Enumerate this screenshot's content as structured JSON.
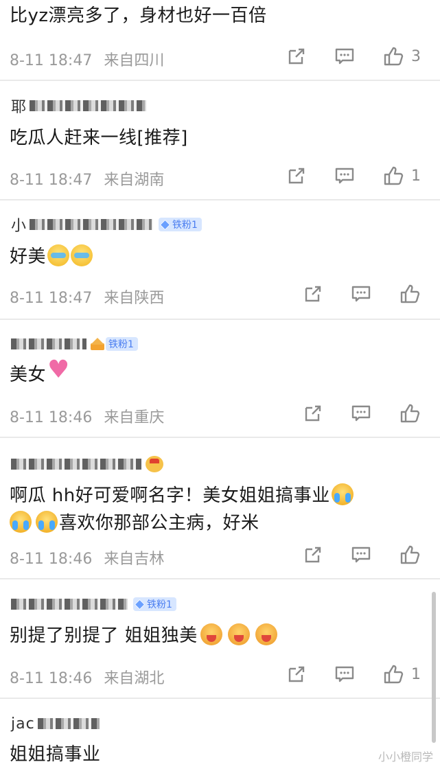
{
  "comments": [
    {
      "username": "",
      "badge": "",
      "text": "比yz漂亮多了，身材也好一百倍",
      "date": "8-11 18:47",
      "location": "来自四川",
      "likes": "3"
    },
    {
      "username": "耶",
      "badge": "",
      "text": "吃瓜人赶来一线[推荐]",
      "date": "8-11 18:47",
      "location": "来自湖南",
      "likes": "1"
    },
    {
      "username": "小",
      "badge": "铁粉1",
      "text": "好美",
      "date": "8-11 18:47",
      "location": "来自陕西",
      "likes": ""
    },
    {
      "username": "",
      "badge": "铁粉1",
      "text": "美女",
      "date": "8-11 18:46",
      "location": "来自重庆",
      "likes": ""
    },
    {
      "username": "",
      "badge": "",
      "text_line1": "啊瓜 hh好可爱啊名字！美女姐姐搞事业",
      "text_line2": "喜欢你那部公主病，好米",
      "date": "8-11 18:46",
      "location": "来自吉林",
      "likes": ""
    },
    {
      "username": "",
      "badge": "铁粉1",
      "text": "别提了别提了  姐姐独美",
      "date": "8-11 18:46",
      "location": "来自湖北",
      "likes": "1"
    },
    {
      "username": "jac",
      "badge": "",
      "text": "姐姐搞事业",
      "date": "",
      "location": "",
      "likes": ""
    }
  ],
  "icons": {
    "repost": "share-icon",
    "comment": "comment-icon",
    "like": "thumbs-up-icon"
  },
  "watermark": "小小橙同学",
  "colors": {
    "badge_bg": "#d7e6ff",
    "badge_text": "#4a7df0",
    "meta_text": "#9a9a9a",
    "separator": "#e9e9e9"
  }
}
